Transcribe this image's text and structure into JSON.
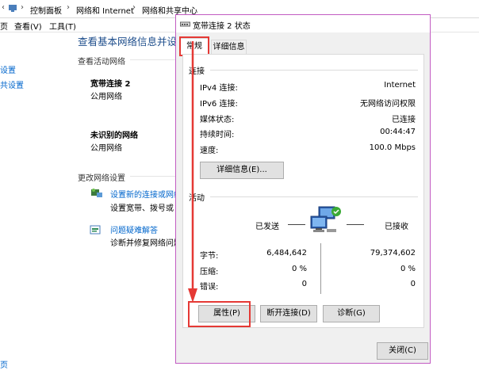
{
  "background": {
    "breadcrumb": [
      "控制面板",
      "网络和 Internet",
      "网络和共享中心"
    ],
    "menu": [
      "查看(V)",
      "工具(T)"
    ],
    "left_partial": [
      "页",
      "设置",
      "共设置",
      "页"
    ],
    "page_heading": "查看基本网络信息并设",
    "active_networks_label": "查看活动网络",
    "network1": {
      "name": "宽带连接 2",
      "type": "公用网络"
    },
    "network2": {
      "name": "未识别的网络",
      "type": "公用网络"
    },
    "change_settings_label": "更改网络设置",
    "task1": {
      "link": "设置新的连接或网络",
      "desc": "设置宽带、拨号或 V"
    },
    "task2": {
      "link": "问题疑难解答",
      "desc": "诊断并修复网络问题"
    }
  },
  "dialog": {
    "title": "宽带连接 2 状态",
    "tabs": [
      "常规",
      "详细信息"
    ],
    "connection_group": "连接",
    "rows": [
      {
        "label": "IPv4 连接:",
        "value": "Internet"
      },
      {
        "label": "IPv6 连接:",
        "value": "无网络访问权限"
      },
      {
        "label": "媒体状态:",
        "value": "已连接"
      },
      {
        "label": "持续时间:",
        "value": "00:44:47"
      },
      {
        "label": "速度:",
        "value": "100.0 Mbps"
      }
    ],
    "details_button": "详细信息(E)...",
    "activity_group": "活动",
    "sent_label": "已发送",
    "received_label": "已接收",
    "stats": [
      {
        "label": "字节:",
        "sent": "6,484,642",
        "received": "79,374,602"
      },
      {
        "label": "压缩:",
        "sent": "0 %",
        "received": "0 %"
      },
      {
        "label": "错误:",
        "sent": "0",
        "received": "0"
      }
    ],
    "properties_button": "属性(P)",
    "disconnect_button": "断开连接(D)",
    "diagnose_button": "诊断(G)",
    "close_button": "关闭(C)",
    "annotation_color": "#e53935"
  }
}
